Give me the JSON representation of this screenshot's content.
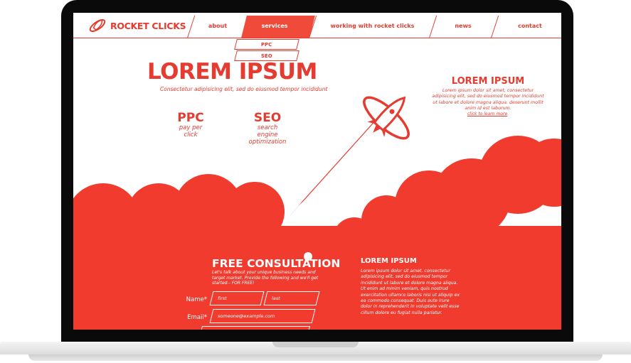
{
  "nav": {
    "logo": "ROCKET CLICKS",
    "items": [
      "about",
      "services",
      "working with rocket clicks",
      "news",
      "contact"
    ],
    "dropdown": [
      "PPC",
      "SEO"
    ]
  },
  "hero": {
    "title": "LOREM IPSUM",
    "subtitle": "Consectetur adipisicing elit, sed do eiusmod tempor incididunt"
  },
  "services": [
    {
      "title": "PPC",
      "desc": [
        "pay per",
        "click"
      ]
    },
    {
      "title": "SEO",
      "desc": [
        "search",
        "engine",
        "optimization"
      ]
    }
  ],
  "side": {
    "title": "LOREM IPSUM",
    "text": "Lorem ipsum dolor sit amet, consectetur adipisicing elit, sed do eiusmod tempor incididunt ut labore et dolore magna aliqua. deserunt mollit anim id est laborum.",
    "link": "click to learn more"
  },
  "consultation": {
    "title": "FREE CONSULTATION",
    "text": "Let's talk about your unique business needs and target market. Provide the following and we'll get started-- FOR FREE!",
    "name_label": "Name*",
    "first_placeholder": "first",
    "last_placeholder": "last",
    "email_label": "Email*",
    "email_placeholder": "someone@example.com"
  },
  "right": {
    "title": "LOREM IPSUM",
    "text": "Lorem ipsum dolor sit amet, consectetur adipisicing elit, sed do eiusmod tempor incididunt ut labore et dolore magna aliqua. Ut enim ad minim veniam, quis nostrud exercitation ullamco laboris nisi ut aliquip ex ea commodo consequat. Duis aute irure dolor in reprehenderit in voluptate velit esse cillum dolore eu fugiat nulla pariatur."
  },
  "colors": {
    "brand": "#e53b30",
    "laptop": "#0a0a0a"
  }
}
